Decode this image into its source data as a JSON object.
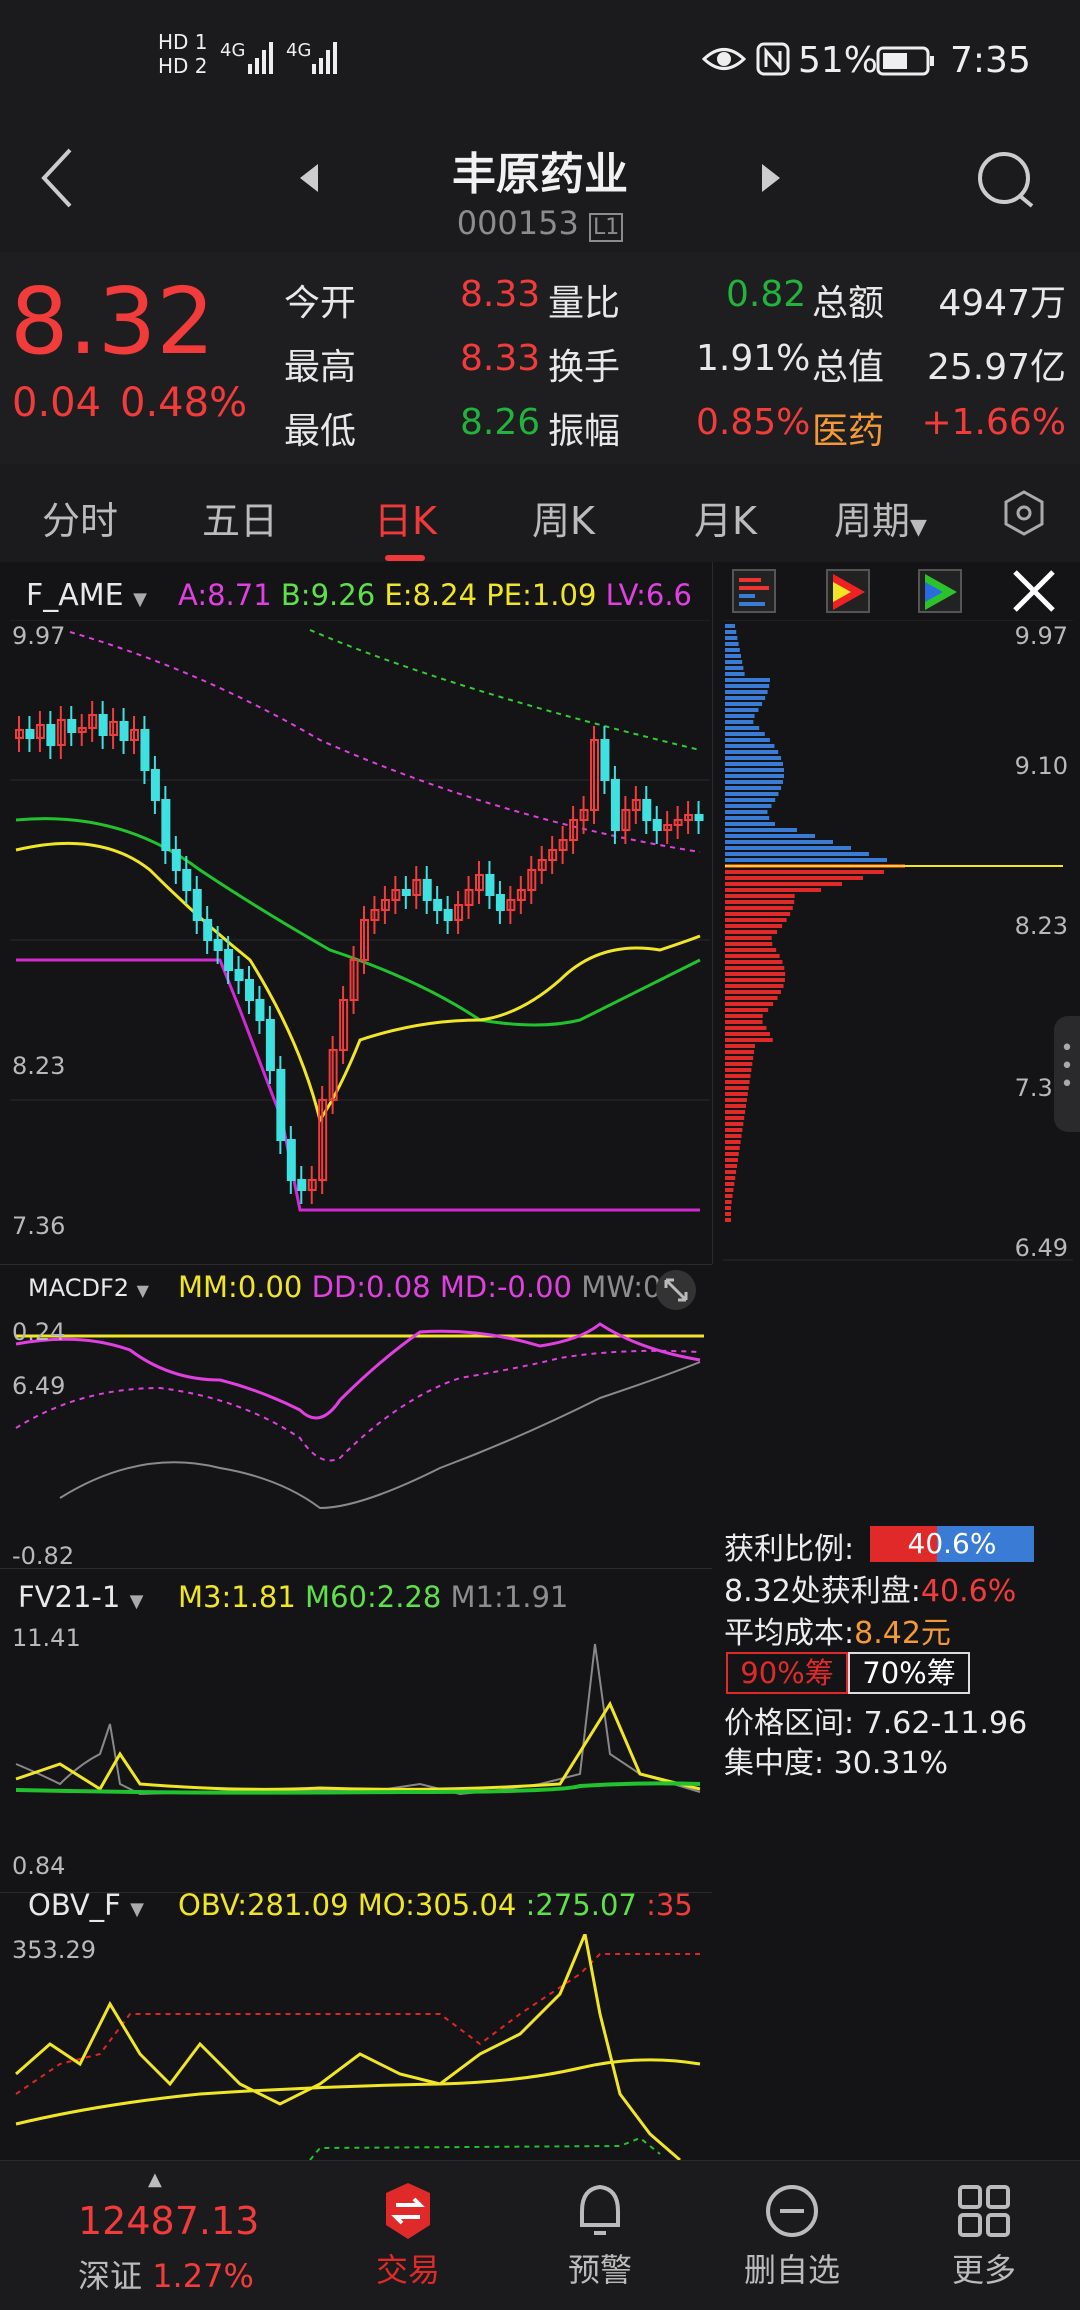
{
  "status": {
    "sim1": "HD 1",
    "sim2": "HD 2",
    "net1": "4G",
    "net2": "4G",
    "icons": [
      "eye-icon",
      "nfc-icon",
      "battery-icon"
    ],
    "battery": "51%",
    "time": "7:35"
  },
  "header": {
    "title": "丰原药业",
    "code": "000153",
    "level": "L1"
  },
  "quote": {
    "price": "8.32",
    "change": "0.04",
    "change_pct": "0.48%",
    "rows": [
      [
        {
          "k": "今开",
          "v": "8.33"
        },
        {
          "k": "量比",
          "v": "0.82"
        },
        {
          "k": "总额",
          "v": "4947万"
        }
      ],
      [
        {
          "k": "最高",
          "v": "8.33"
        },
        {
          "k": "换手",
          "v": "1.91%"
        },
        {
          "k": "总值",
          "v": "25.97亿"
        }
      ],
      [
        {
          "k": "最低",
          "v": "8.26"
        },
        {
          "k": "振幅",
          "v": "0.85%"
        },
        {
          "k": "医药",
          "v": "+1.66%"
        }
      ]
    ]
  },
  "tabs": [
    "分时",
    "五日",
    "日K",
    "周K",
    "月K",
    "周期"
  ],
  "active_tab": "日K",
  "main_indicator": {
    "name": "F_AME",
    "items": [
      {
        "label": "A:",
        "value": "8.71"
      },
      {
        "label": "B:",
        "value": "9.26"
      },
      {
        "label": "E:",
        "value": "8.24"
      },
      {
        "label": "PE:",
        "value": "1.09"
      },
      {
        "label": "LV:",
        "value": "6.6"
      }
    ],
    "axis": [
      "9.97",
      "9.10",
      "8.23",
      "7.36",
      "6.49"
    ]
  },
  "macd": {
    "name": "MACDF2",
    "items": [
      {
        "label": "MM:",
        "value": "0.00"
      },
      {
        "label": "DD:",
        "value": "0.08"
      },
      {
        "label": "MD:",
        "value": "-0.00"
      },
      {
        "label": "MW:",
        "value": "0"
      }
    ],
    "axis_top": "0.24",
    "axis_bottom": "-0.82"
  },
  "fv": {
    "name": "FV21-1",
    "items": [
      {
        "label": "M3:",
        "value": "1.81"
      },
      {
        "label": "M60:",
        "value": "2.28"
      },
      {
        "label": "M1:",
        "value": "1.91"
      }
    ],
    "axis_top": "11.41",
    "axis_bottom": "0.84"
  },
  "obv": {
    "name": "OBV_F",
    "items": [
      {
        "label": "OBV:",
        "value": "281.09"
      },
      {
        "label": "MO:",
        "value": "305.04"
      },
      {
        "label": ":",
        "value": "275.07"
      },
      {
        "label": ":",
        "value": "35"
      }
    ],
    "axis_top": "353.29"
  },
  "chip_panel": {
    "axis": [
      "9.97",
      "9.10",
      "8.23",
      "7.36",
      "6.49"
    ],
    "profit_ratio_label": "获利比例:",
    "profit_ratio": "40.6%",
    "profit_ratio_value": 0.406,
    "profit_at_label": "8.32处获利盘:",
    "profit_at": "40.6%",
    "avg_cost_label": "平均成本:",
    "avg_cost": "8.42元",
    "btn_90": "90%筹",
    "btn_70": "70%筹",
    "range_label": "价格区间:",
    "range": "7.62-11.96",
    "concentration_label": "集中度:",
    "concentration": "30.31%"
  },
  "bottom_nav": {
    "index_value": "12487.13",
    "index_name": "深证",
    "index_pct": "1.27%",
    "items": [
      "交易",
      "预警",
      "删自选",
      "更多"
    ]
  }
}
